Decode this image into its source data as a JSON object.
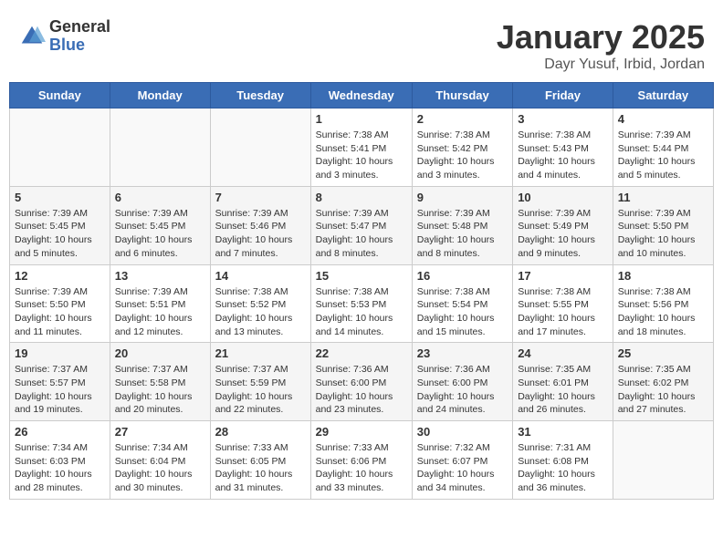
{
  "header": {
    "logo_general": "General",
    "logo_blue": "Blue",
    "month_title": "January 2025",
    "location": "Dayr Yusuf, Irbid, Jordan"
  },
  "weekdays": [
    "Sunday",
    "Monday",
    "Tuesday",
    "Wednesday",
    "Thursday",
    "Friday",
    "Saturday"
  ],
  "weeks": [
    [
      {
        "day": "",
        "sunrise": "",
        "sunset": "",
        "daylight": ""
      },
      {
        "day": "",
        "sunrise": "",
        "sunset": "",
        "daylight": ""
      },
      {
        "day": "",
        "sunrise": "",
        "sunset": "",
        "daylight": ""
      },
      {
        "day": "1",
        "sunrise": "Sunrise: 7:38 AM",
        "sunset": "Sunset: 5:41 PM",
        "daylight": "Daylight: 10 hours and 3 minutes."
      },
      {
        "day": "2",
        "sunrise": "Sunrise: 7:38 AM",
        "sunset": "Sunset: 5:42 PM",
        "daylight": "Daylight: 10 hours and 3 minutes."
      },
      {
        "day": "3",
        "sunrise": "Sunrise: 7:38 AM",
        "sunset": "Sunset: 5:43 PM",
        "daylight": "Daylight: 10 hours and 4 minutes."
      },
      {
        "day": "4",
        "sunrise": "Sunrise: 7:39 AM",
        "sunset": "Sunset: 5:44 PM",
        "daylight": "Daylight: 10 hours and 5 minutes."
      }
    ],
    [
      {
        "day": "5",
        "sunrise": "Sunrise: 7:39 AM",
        "sunset": "Sunset: 5:45 PM",
        "daylight": "Daylight: 10 hours and 5 minutes."
      },
      {
        "day": "6",
        "sunrise": "Sunrise: 7:39 AM",
        "sunset": "Sunset: 5:45 PM",
        "daylight": "Daylight: 10 hours and 6 minutes."
      },
      {
        "day": "7",
        "sunrise": "Sunrise: 7:39 AM",
        "sunset": "Sunset: 5:46 PM",
        "daylight": "Daylight: 10 hours and 7 minutes."
      },
      {
        "day": "8",
        "sunrise": "Sunrise: 7:39 AM",
        "sunset": "Sunset: 5:47 PM",
        "daylight": "Daylight: 10 hours and 8 minutes."
      },
      {
        "day": "9",
        "sunrise": "Sunrise: 7:39 AM",
        "sunset": "Sunset: 5:48 PM",
        "daylight": "Daylight: 10 hours and 8 minutes."
      },
      {
        "day": "10",
        "sunrise": "Sunrise: 7:39 AM",
        "sunset": "Sunset: 5:49 PM",
        "daylight": "Daylight: 10 hours and 9 minutes."
      },
      {
        "day": "11",
        "sunrise": "Sunrise: 7:39 AM",
        "sunset": "Sunset: 5:50 PM",
        "daylight": "Daylight: 10 hours and 10 minutes."
      }
    ],
    [
      {
        "day": "12",
        "sunrise": "Sunrise: 7:39 AM",
        "sunset": "Sunset: 5:50 PM",
        "daylight": "Daylight: 10 hours and 11 minutes."
      },
      {
        "day": "13",
        "sunrise": "Sunrise: 7:39 AM",
        "sunset": "Sunset: 5:51 PM",
        "daylight": "Daylight: 10 hours and 12 minutes."
      },
      {
        "day": "14",
        "sunrise": "Sunrise: 7:38 AM",
        "sunset": "Sunset: 5:52 PM",
        "daylight": "Daylight: 10 hours and 13 minutes."
      },
      {
        "day": "15",
        "sunrise": "Sunrise: 7:38 AM",
        "sunset": "Sunset: 5:53 PM",
        "daylight": "Daylight: 10 hours and 14 minutes."
      },
      {
        "day": "16",
        "sunrise": "Sunrise: 7:38 AM",
        "sunset": "Sunset: 5:54 PM",
        "daylight": "Daylight: 10 hours and 15 minutes."
      },
      {
        "day": "17",
        "sunrise": "Sunrise: 7:38 AM",
        "sunset": "Sunset: 5:55 PM",
        "daylight": "Daylight: 10 hours and 17 minutes."
      },
      {
        "day": "18",
        "sunrise": "Sunrise: 7:38 AM",
        "sunset": "Sunset: 5:56 PM",
        "daylight": "Daylight: 10 hours and 18 minutes."
      }
    ],
    [
      {
        "day": "19",
        "sunrise": "Sunrise: 7:37 AM",
        "sunset": "Sunset: 5:57 PM",
        "daylight": "Daylight: 10 hours and 19 minutes."
      },
      {
        "day": "20",
        "sunrise": "Sunrise: 7:37 AM",
        "sunset": "Sunset: 5:58 PM",
        "daylight": "Daylight: 10 hours and 20 minutes."
      },
      {
        "day": "21",
        "sunrise": "Sunrise: 7:37 AM",
        "sunset": "Sunset: 5:59 PM",
        "daylight": "Daylight: 10 hours and 22 minutes."
      },
      {
        "day": "22",
        "sunrise": "Sunrise: 7:36 AM",
        "sunset": "Sunset: 6:00 PM",
        "daylight": "Daylight: 10 hours and 23 minutes."
      },
      {
        "day": "23",
        "sunrise": "Sunrise: 7:36 AM",
        "sunset": "Sunset: 6:00 PM",
        "daylight": "Daylight: 10 hours and 24 minutes."
      },
      {
        "day": "24",
        "sunrise": "Sunrise: 7:35 AM",
        "sunset": "Sunset: 6:01 PM",
        "daylight": "Daylight: 10 hours and 26 minutes."
      },
      {
        "day": "25",
        "sunrise": "Sunrise: 7:35 AM",
        "sunset": "Sunset: 6:02 PM",
        "daylight": "Daylight: 10 hours and 27 minutes."
      }
    ],
    [
      {
        "day": "26",
        "sunrise": "Sunrise: 7:34 AM",
        "sunset": "Sunset: 6:03 PM",
        "daylight": "Daylight: 10 hours and 28 minutes."
      },
      {
        "day": "27",
        "sunrise": "Sunrise: 7:34 AM",
        "sunset": "Sunset: 6:04 PM",
        "daylight": "Daylight: 10 hours and 30 minutes."
      },
      {
        "day": "28",
        "sunrise": "Sunrise: 7:33 AM",
        "sunset": "Sunset: 6:05 PM",
        "daylight": "Daylight: 10 hours and 31 minutes."
      },
      {
        "day": "29",
        "sunrise": "Sunrise: 7:33 AM",
        "sunset": "Sunset: 6:06 PM",
        "daylight": "Daylight: 10 hours and 33 minutes."
      },
      {
        "day": "30",
        "sunrise": "Sunrise: 7:32 AM",
        "sunset": "Sunset: 6:07 PM",
        "daylight": "Daylight: 10 hours and 34 minutes."
      },
      {
        "day": "31",
        "sunrise": "Sunrise: 7:31 AM",
        "sunset": "Sunset: 6:08 PM",
        "daylight": "Daylight: 10 hours and 36 minutes."
      },
      {
        "day": "",
        "sunrise": "",
        "sunset": "",
        "daylight": ""
      }
    ]
  ]
}
